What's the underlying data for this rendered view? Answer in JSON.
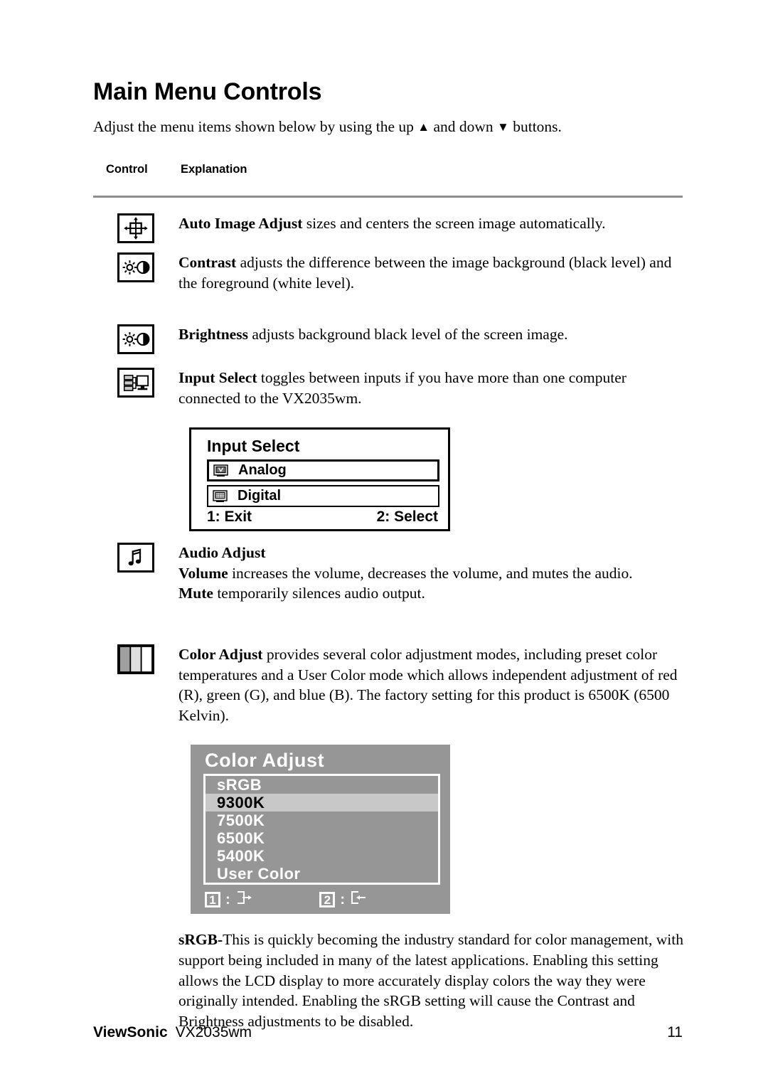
{
  "document": {
    "title": "Main Menu Controls",
    "intro_before": "Adjust the menu items shown below by using the up ",
    "intro_up_glyph": "▲",
    "intro_mid": " and down ",
    "intro_down_glyph": "▼",
    "intro_after": " buttons."
  },
  "table": {
    "header_control": "Control",
    "header_explanation": "Explanation"
  },
  "rows": {
    "auto_image_adjust": {
      "icon": "auto-image-adjust-icon",
      "term": "Auto Image Adjust",
      "text": " sizes and centers the screen image automatically."
    },
    "contrast": {
      "icon": "contrast-icon",
      "term": "Contrast",
      "text": " adjusts the difference between the image background  (black level) and the foreground (white level)."
    },
    "brightness": {
      "icon": "brightness-icon",
      "term": "Brightness",
      "text": " adjusts background black level of the screen image."
    },
    "input_select": {
      "icon": "input-select-icon",
      "term": "Input Select",
      "text": " toggles between inputs if you have more than one computer connected to the VX2035wm."
    },
    "audio_adjust": {
      "icon": "audio-adjust-icon",
      "heading": "Audio Adjust",
      "volume_term": "Volume",
      "volume_text": " increases the volume, decreases the volume, and mutes the audio.",
      "mute_term": "Mute",
      "mute_text": " temporarily silences audio output."
    },
    "color_adjust": {
      "icon": "color-adjust-icon",
      "term": "Color Adjust",
      "text": " provides several color adjustment modes, including preset color temperatures and a User Color mode which allows independent adjustment of red (R), green (G), and blue (B). The factory setting for this product is 6500K (6500 Kelvin)."
    }
  },
  "osd_input_select": {
    "title": "Input Select",
    "options": [
      {
        "label": "Analog",
        "icon": "analog-monitor-icon",
        "selected": true
      },
      {
        "label": "Digital",
        "icon": "digital-monitor-icon",
        "selected": false
      }
    ],
    "foot_left": "1: Exit",
    "foot_right": "2: Select"
  },
  "osd_color_adjust": {
    "title": "Color Adjust",
    "background_color": "#969696",
    "highlight_color": "#c8c8c8",
    "text_color": "#ffffff",
    "items": [
      {
        "label": "sRGB",
        "highlighted": false
      },
      {
        "label": "9300K",
        "highlighted": true
      },
      {
        "label": "7500K",
        "highlighted": false
      },
      {
        "label": "6500K",
        "highlighted": false
      },
      {
        "label": "5400K",
        "highlighted": false
      },
      {
        "label": "User Color",
        "highlighted": false
      }
    ],
    "key_left": "1",
    "key_left_icon": "exit-arrow-icon",
    "key_right": "2",
    "key_right_icon": "enter-arrow-icon",
    "colon": ":"
  },
  "srgb_paragraph": {
    "term": "sRGB-",
    "text": "This is quickly becoming the industry standard for color management, with support being included in many of the latest applications. Enabling this setting allows the LCD display to more accurately display colors the way they were originally intended. Enabling the sRGB setting will cause the Contrast and Brightness adjustments to be disabled."
  },
  "footer": {
    "brand": "ViewSonic",
    "model": "VX2035wm",
    "page_number": "11"
  }
}
